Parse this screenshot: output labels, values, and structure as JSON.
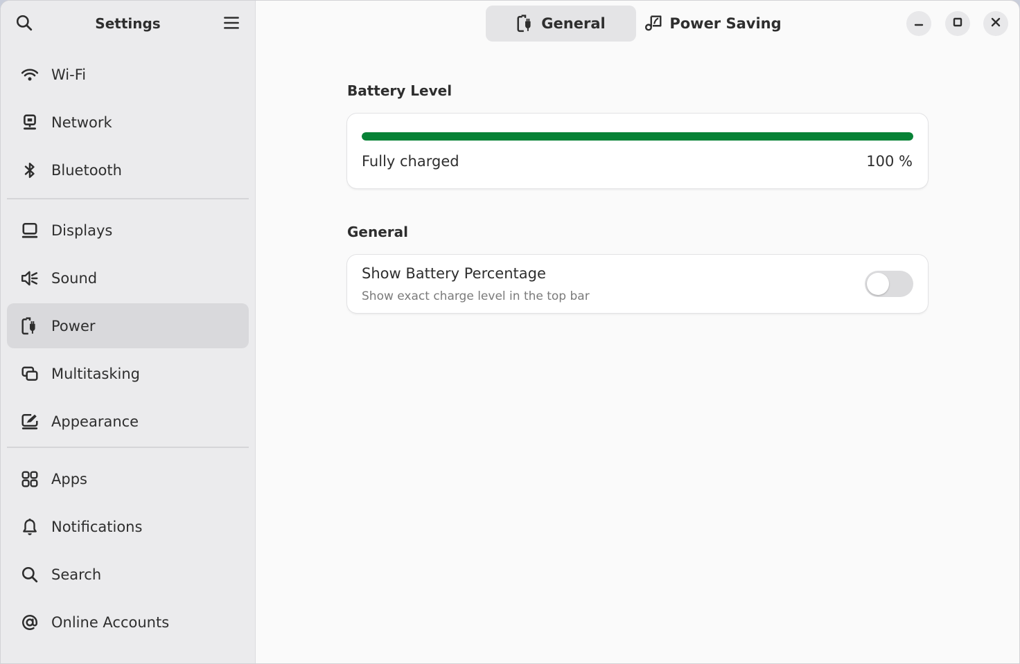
{
  "sidebar": {
    "title": "Settings",
    "search_icon": "search-icon",
    "menu_icon": "hamburger-menu-icon",
    "groups": [
      [
        {
          "label": "Wi-Fi",
          "icon": "wifi-icon"
        },
        {
          "label": "Network",
          "icon": "network-icon"
        },
        {
          "label": "Bluetooth",
          "icon": "bluetooth-icon"
        }
      ],
      [
        {
          "label": "Displays",
          "icon": "display-icon"
        },
        {
          "label": "Sound",
          "icon": "speaker-icon"
        },
        {
          "label": "Power",
          "icon": "power-icon",
          "active": true
        },
        {
          "label": "Multitasking",
          "icon": "multitasking-icon"
        },
        {
          "label": "Appearance",
          "icon": "appearance-icon"
        }
      ],
      [
        {
          "label": "Apps",
          "icon": "apps-grid-icon"
        },
        {
          "label": "Notifications",
          "icon": "bell-icon"
        },
        {
          "label": "Search",
          "icon": "search-icon"
        },
        {
          "label": "Online Accounts",
          "icon": "at-sign-icon"
        }
      ]
    ]
  },
  "tabs": [
    {
      "label": "General",
      "icon": "power-plug-icon",
      "active": true
    },
    {
      "label": "Power Saving",
      "icon": "leaf-icon",
      "active": false
    }
  ],
  "window_controls": [
    "minimize-icon",
    "maximize-icon",
    "close-icon"
  ],
  "battery": {
    "section_title": "Battery Level",
    "status": "Fully charged",
    "percent_text": "100 %",
    "level": 1.0,
    "bar_color": "#078236"
  },
  "general": {
    "section_title": "General",
    "show_percentage": {
      "title": "Show Battery Percentage",
      "subtitle": "Show exact charge level in the top bar",
      "enabled": false
    }
  },
  "colors": {
    "accent_green": "#078236",
    "sidebar_bg": "#ebebed",
    "active_item_bg": "#d9d9dc"
  }
}
